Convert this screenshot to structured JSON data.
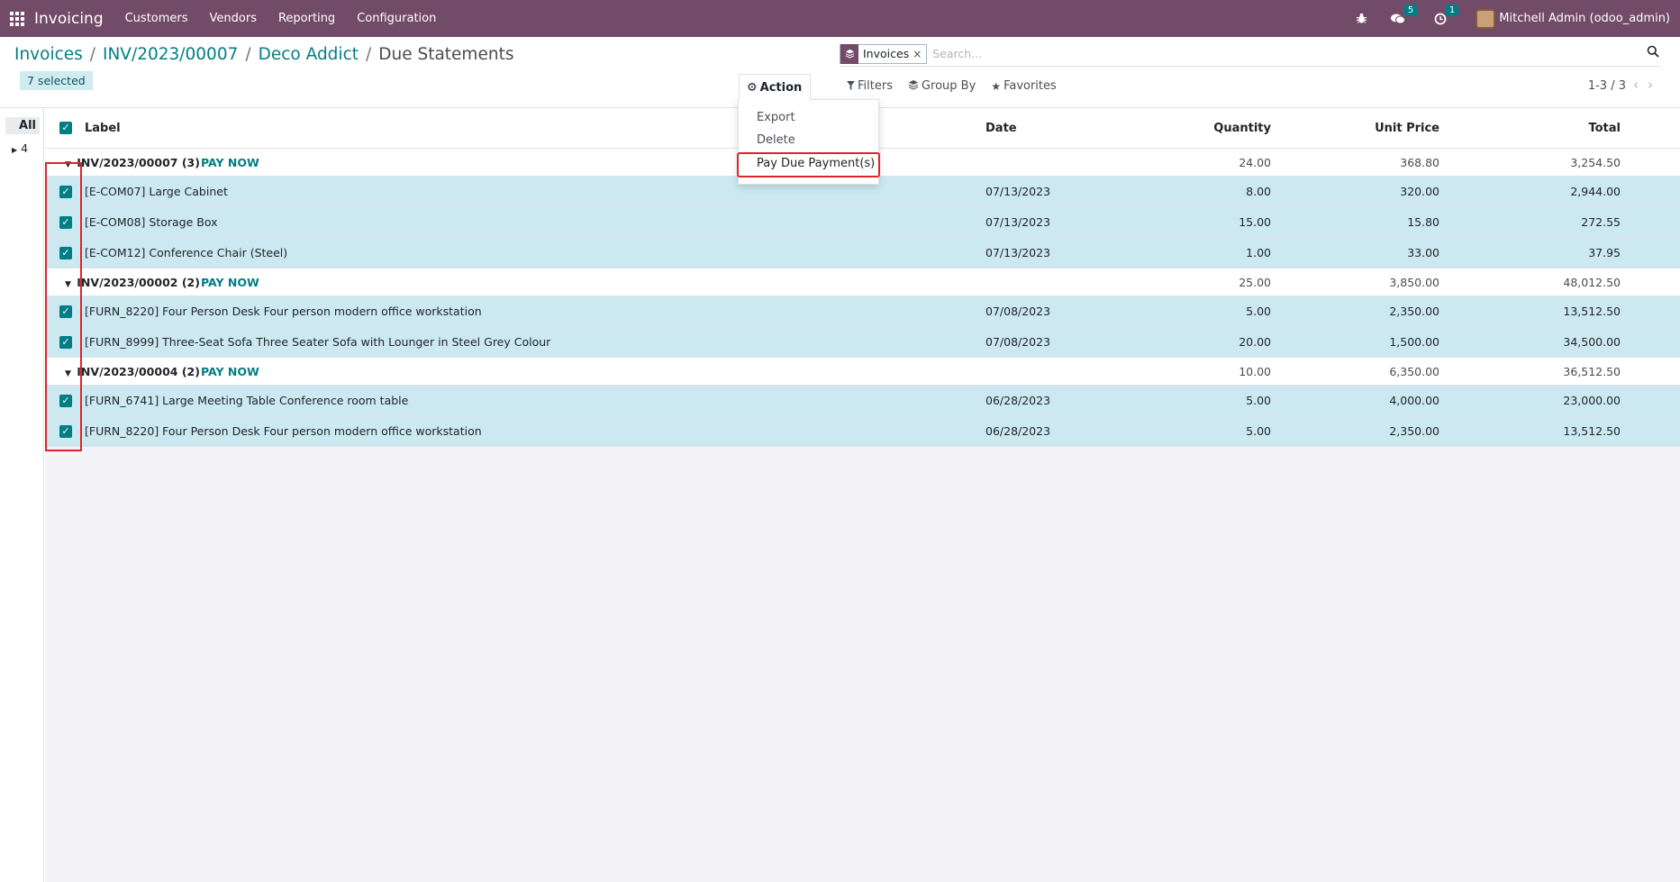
{
  "navbar": {
    "brand": "Invoicing",
    "menu": [
      "Customers",
      "Vendors",
      "Reporting",
      "Configuration"
    ],
    "messages_count": "5",
    "activities_count": "1",
    "user": "Mitchell Admin (odoo_admin)"
  },
  "breadcrumb": {
    "items": [
      "Invoices",
      "INV/2023/00007",
      "Deco Addict"
    ],
    "current": "Due Statements"
  },
  "selection": {
    "label": "7 selected"
  },
  "search": {
    "facet_label": "Invoices",
    "placeholder": "Search..."
  },
  "action_menu": {
    "label": "Action",
    "items": [
      "Export",
      "Delete",
      "Pay Due Payment(s)"
    ]
  },
  "filters": {
    "filters_label": "Filters",
    "groupby_label": "Group By",
    "favorites_label": "Favorites"
  },
  "pager": {
    "value": "1-3 / 3"
  },
  "sidebar": {
    "all_label": "All",
    "group_count": "4"
  },
  "table": {
    "columns": [
      "Label",
      "Date",
      "Quantity",
      "Unit Price",
      "Total"
    ],
    "pay_now_label": "PAY NOW",
    "groups": [
      {
        "name": "INV/2023/00007 (3)",
        "quantity": "24.00",
        "unit_price": "368.80",
        "total": "3,254.50",
        "rows": [
          {
            "label": "[E-COM07] Large Cabinet",
            "date": "07/13/2023",
            "quantity": "8.00",
            "unit_price": "320.00",
            "total": "2,944.00"
          },
          {
            "label": "[E-COM08] Storage Box",
            "date": "07/13/2023",
            "quantity": "15.00",
            "unit_price": "15.80",
            "total": "272.55"
          },
          {
            "label": "[E-COM12] Conference Chair (Steel)",
            "date": "07/13/2023",
            "quantity": "1.00",
            "unit_price": "33.00",
            "total": "37.95"
          }
        ]
      },
      {
        "name": "INV/2023/00002 (2)",
        "quantity": "25.00",
        "unit_price": "3,850.00",
        "total": "48,012.50",
        "rows": [
          {
            "label": "[FURN_8220] Four Person Desk Four person modern office workstation",
            "date": "07/08/2023",
            "quantity": "5.00",
            "unit_price": "2,350.00",
            "total": "13,512.50"
          },
          {
            "label": "[FURN_8999] Three-Seat Sofa Three Seater Sofa with Lounger in Steel Grey Colour",
            "date": "07/08/2023",
            "quantity": "20.00",
            "unit_price": "1,500.00",
            "total": "34,500.00"
          }
        ]
      },
      {
        "name": "INV/2023/00004 (2)",
        "quantity": "10.00",
        "unit_price": "6,350.00",
        "total": "36,512.50",
        "rows": [
          {
            "label": "[FURN_6741] Large Meeting Table Conference room table",
            "date": "06/28/2023",
            "quantity": "5.00",
            "unit_price": "4,000.00",
            "total": "23,000.00"
          },
          {
            "label": "[FURN_8220] Four Person Desk Four person modern office workstation",
            "date": "06/28/2023",
            "quantity": "5.00",
            "unit_price": "2,350.00",
            "total": "13,512.50"
          }
        ]
      }
    ]
  },
  "colors": {
    "navbar": "#714b67",
    "accent": "#017e84",
    "selected_row": "#cce9f1",
    "highlight_box": "#e0232a"
  }
}
